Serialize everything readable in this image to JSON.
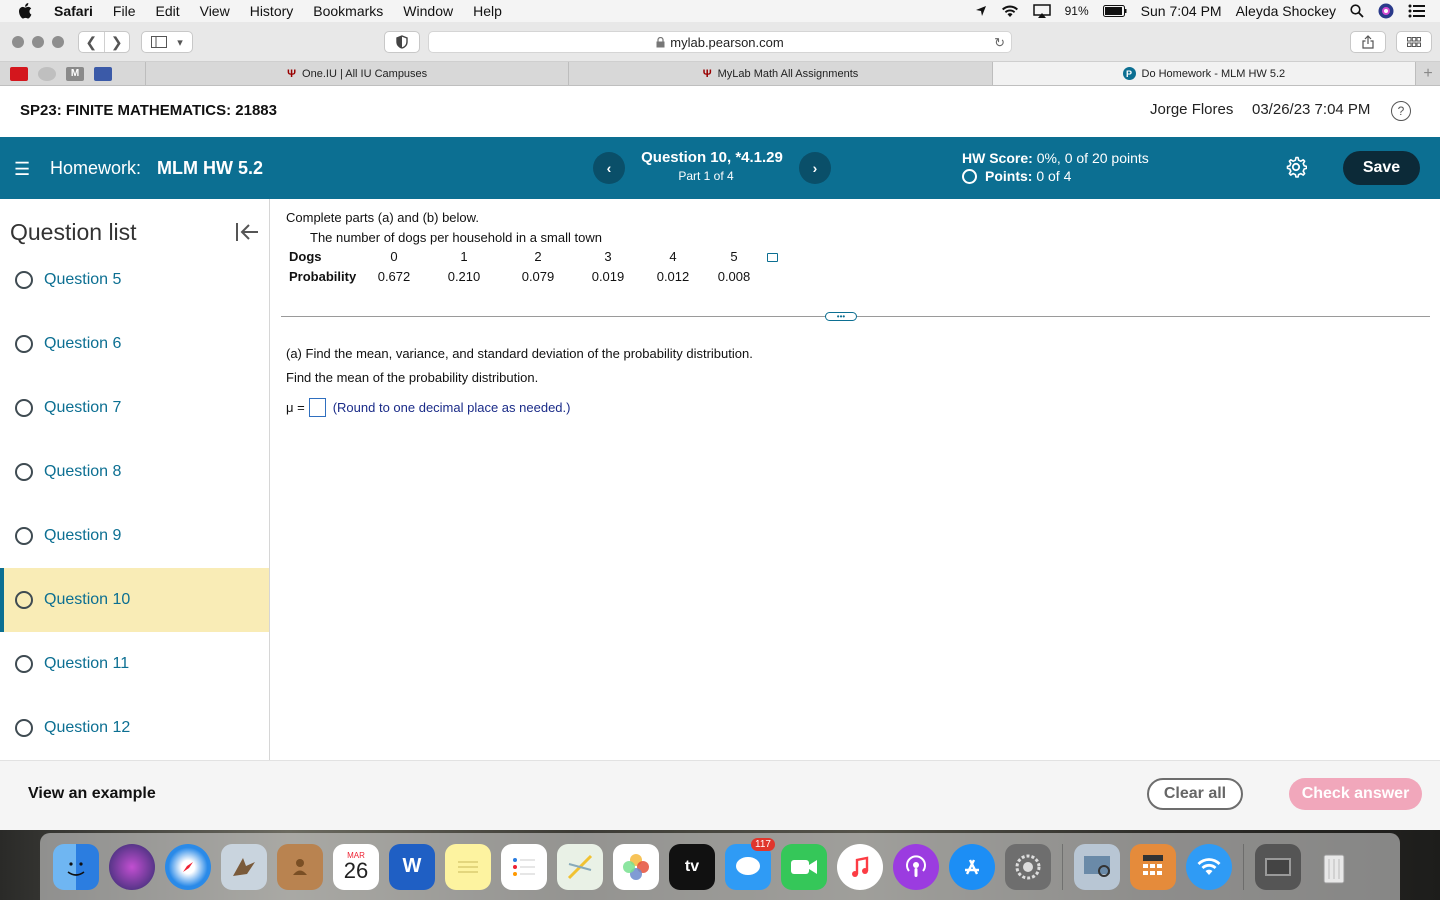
{
  "menubar": {
    "app": "Safari",
    "items": [
      "File",
      "Edit",
      "View",
      "History",
      "Bookmarks",
      "Window",
      "Help"
    ],
    "battery": "91%",
    "clock": "Sun 7:04 PM",
    "user": "Aleyda Shockey"
  },
  "browser": {
    "url": "mylab.pearson.com",
    "tabs": [
      {
        "label": "One.IU | All IU Campuses",
        "icon": "iu-logo-icon"
      },
      {
        "label": "MyLab Math All Assignments",
        "icon": "iu-logo-icon"
      },
      {
        "label": "Do Homework - MLM HW 5.2",
        "icon": "pearson-logo-icon"
      }
    ]
  },
  "course": {
    "title": "SP23: FINITE MATHEMATICS: 21883",
    "user": "Jorge Flores",
    "datetime": "03/26/23 7:04 PM",
    "help": "?"
  },
  "homework": {
    "label": "Homework:",
    "name": "MLM HW 5.2",
    "question_title": "Question 10, *4.1.29",
    "part": "Part 1 of 4",
    "hw_score_label": "HW Score:",
    "hw_score_value": "0%, 0 of 20 points",
    "points_label": "Points:",
    "points_value": "0 of 4",
    "save": "Save"
  },
  "sidebar": {
    "title": "Question list",
    "questions": [
      "Question 5",
      "Question 6",
      "Question 7",
      "Question 8",
      "Question 9",
      "Question 10",
      "Question 11",
      "Question 12"
    ],
    "active": "Question 10"
  },
  "question": {
    "instruction": "Complete parts (a) and (b) below.",
    "table_caption": "The number of dogs per household in a small town",
    "row_headers": [
      "Dogs",
      "Probability"
    ],
    "dogs": [
      "0",
      "1",
      "2",
      "3",
      "4",
      "5"
    ],
    "probability": [
      "0.672",
      "0.210",
      "0.079",
      "0.019",
      "0.012",
      "0.008"
    ],
    "part_a": "(a) Find the mean, variance, and standard deviation of the probability distribution.",
    "find_mean": "Find the mean of the probability distribution.",
    "mu_label": "μ =",
    "round_note": "(Round to one decimal place as needed.)"
  },
  "actions": {
    "view_example": "View an example",
    "clear_all": "Clear all",
    "check_answer": "Check answer"
  },
  "dock": {
    "calendar_month": "MAR",
    "calendar_day": "26",
    "messages_badge": "117",
    "tv_label": "tv"
  }
}
